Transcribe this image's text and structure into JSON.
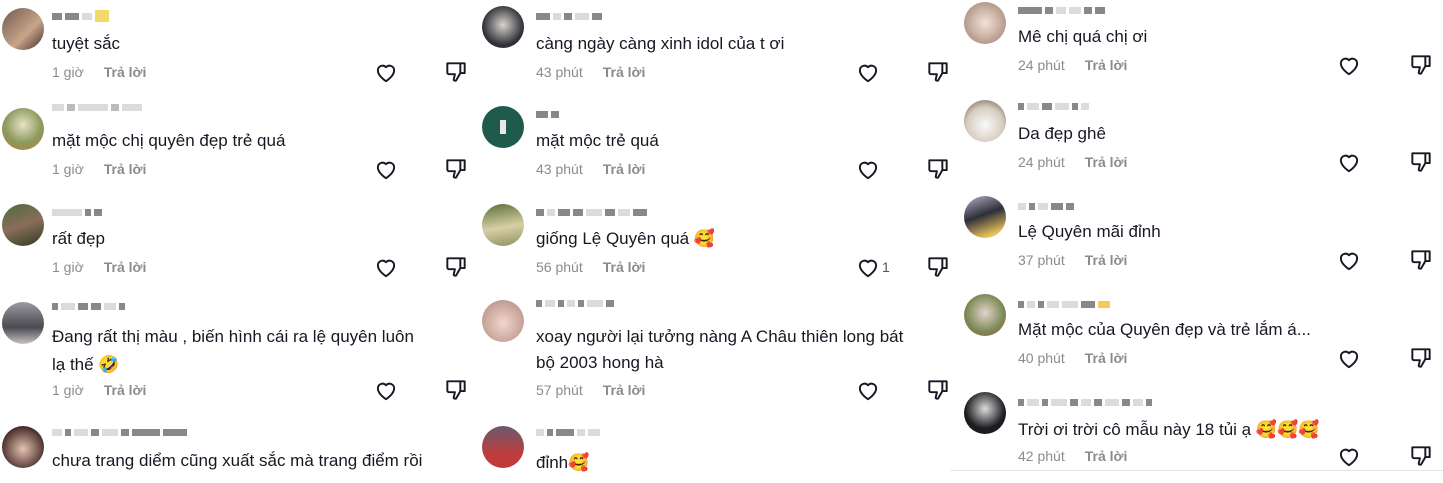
{
  "columns": [
    {
      "comments": [
        {
          "text": "tuyệt sắc",
          "time": "1 giờ",
          "reply": "Trả lời",
          "likes": ""
        },
        {
          "text": "mặt mộc chị quyên đẹp trẻ quá",
          "time": "1 giờ",
          "reply": "Trả lời",
          "likes": ""
        },
        {
          "text": "rất đẹp",
          "time": "1 giờ",
          "reply": "Trả lời",
          "likes": ""
        },
        {
          "text": "Đang rất thị màu , biến hình cái ra lệ quyên luôn",
          "text2": "lạ thế 🤣",
          "time": "1 giờ",
          "reply": "Trả lời",
          "likes": ""
        },
        {
          "text": "chưa trang diểm cũng xuất sắc mà trang điểm rồi",
          "time": "",
          "reply": "",
          "likes": ""
        }
      ]
    },
    {
      "comments": [
        {
          "text": "càng ngày càng xinh idol của t ơi",
          "time": "43 phút",
          "reply": "Trả lời",
          "likes": ""
        },
        {
          "text": "mặt mộc trẻ quá",
          "time": "43 phút",
          "reply": "Trả lời",
          "likes": ""
        },
        {
          "text": "giống Lệ Quyên quá 🥰",
          "time": "56 phút",
          "reply": "Trả lời",
          "likes": "1"
        },
        {
          "text": "xoay người lại tưởng nàng A Châu thiên long bát",
          "text2": "bộ 2003 hong hà",
          "time": "57 phút",
          "reply": "Trả lời",
          "likes": ""
        },
        {
          "text": "đỉnh🥰",
          "time": "",
          "reply": "",
          "likes": ""
        }
      ]
    },
    {
      "comments": [
        {
          "text": "Mê chị quá chị ơi",
          "time": "24 phút",
          "reply": "Trả lời",
          "likes": ""
        },
        {
          "text": "Da đẹp ghê",
          "time": "24 phút",
          "reply": "Trả lời",
          "likes": ""
        },
        {
          "text": "Lệ Quyên mãi đỉnh",
          "time": "37 phút",
          "reply": "Trả lời",
          "likes": ""
        },
        {
          "text": "Mặt mộc của Quyên đẹp và trẻ lắm á...",
          "time": "40 phút",
          "reply": "Trả lời",
          "likes": ""
        },
        {
          "text": "Trời ơi trời cô mẫu này 18 tủi ạ 🥰🥰🥰",
          "time": "42 phút",
          "reply": "Trả lời",
          "likes": ""
        }
      ]
    }
  ],
  "icons": {
    "like": "heart-outline-icon",
    "dislike": "thumbs-down-outline-icon"
  },
  "colors": {
    "text": "#161823",
    "meta": "#8a8b91",
    "icon": "#161823"
  }
}
